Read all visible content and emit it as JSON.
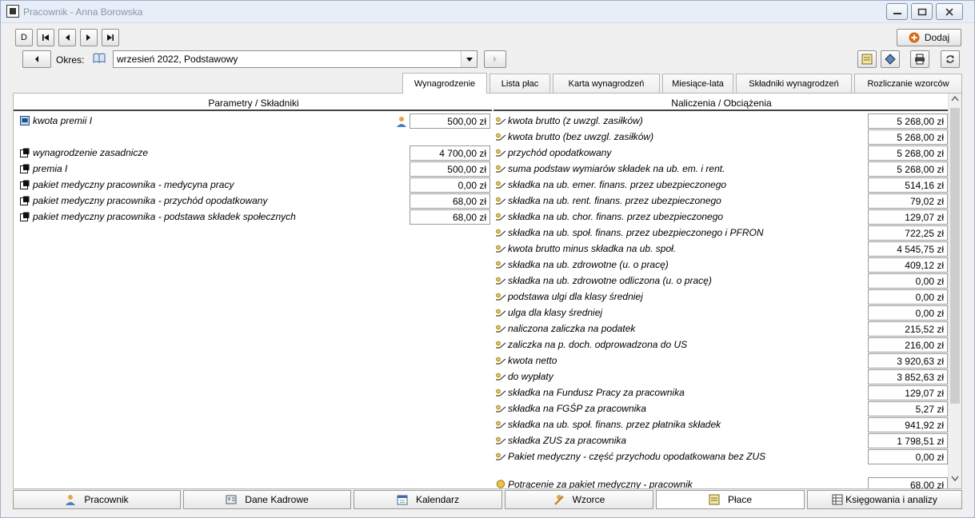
{
  "window": {
    "title": "Pracownik - Anna Borowska"
  },
  "toolbar": {
    "nav_first": "D",
    "nav_prev_record": "⏮",
    "nav_prev": "◀",
    "nav_next": "▶",
    "nav_last": "⏭",
    "add_label": "Dodaj",
    "period_prev": "◀",
    "period_label": "Okres:",
    "period_value": "wrzesień 2022, Podstawowy",
    "period_next": "▶"
  },
  "tabs": [
    {
      "label": "Wynagrodzenie",
      "active": true
    },
    {
      "label": "Lista płac",
      "active": false
    },
    {
      "label": "Karta wynagrodzeń",
      "active": false
    },
    {
      "label": "Miesiące-lata",
      "active": false
    },
    {
      "label": "Składniki wynagrodzeń",
      "active": false
    },
    {
      "label": "Rozliczanie wzorców",
      "active": false
    }
  ],
  "left_header": "Parametry / Składniki",
  "right_header": "Naliczenia / Obciążenia",
  "parameters": [
    {
      "label": "kwota premii I",
      "value": "500,00 zł",
      "type": "param"
    },
    {
      "label": "wynagrodzenie zasadnicze",
      "value": "4 700,00 zł",
      "type": "component"
    },
    {
      "label": "premia I",
      "value": "500,00 zł",
      "type": "component"
    },
    {
      "label": "pakiet medyczny pracownika - medycyna pracy",
      "value": "0,00 zł",
      "type": "component"
    },
    {
      "label": "pakiet medyczny pracownika - przychód opodatkowany",
      "value": "68,00 zł",
      "type": "component"
    },
    {
      "label": "pakiet medyczny pracownika - podstawa składek społecznych",
      "value": "68,00 zł",
      "type": "component"
    }
  ],
  "calculations": [
    {
      "label": "kwota brutto (z uwzgl. zasiłków)",
      "value": "5 268,00 zł"
    },
    {
      "label": "kwota brutto (bez uwzgl. zasiłków)",
      "value": "5 268,00 zł"
    },
    {
      "label": "przychód opodatkowany",
      "value": "5 268,00 zł"
    },
    {
      "label": "suma podstaw wymiarów składek na ub. em. i rent.",
      "value": "5 268,00 zł"
    },
    {
      "label": "składka na ub. emer. finans. przez ubezpieczonego",
      "value": "514,16 zł"
    },
    {
      "label": "składka na ub. rent. finans. przez ubezpieczonego",
      "value": "79,02 zł"
    },
    {
      "label": "składka na ub. chor. finans. przez ubezpieczonego",
      "value": "129,07 zł"
    },
    {
      "label": "składka na ub. społ. finans. przez ubezpieczonego i PFRON",
      "value": "722,25 zł"
    },
    {
      "label": "kwota brutto minus składka na ub. społ.",
      "value": "4 545,75 zł"
    },
    {
      "label": "składka na ub. zdrowotne (u. o pracę)",
      "value": "409,12 zł"
    },
    {
      "label": "składka na ub. zdrowotne odliczona (u. o pracę)",
      "value": "0,00 zł"
    },
    {
      "label": "podstawa ulgi dla klasy średniej",
      "value": "0,00 zł"
    },
    {
      "label": "ulga dla klasy średniej",
      "value": "0,00 zł"
    },
    {
      "label": "naliczona zaliczka na podatek",
      "value": "215,52 zł"
    },
    {
      "label": "zaliczka na p. doch. odprowadzona do US",
      "value": "216,00 zł"
    },
    {
      "label": "kwota netto",
      "value": "3 920,63 zł"
    },
    {
      "label": "do wypłaty",
      "value": "3 852,63 zł"
    },
    {
      "label": "składka na Fundusz Pracy za pracownika",
      "value": "129,07 zł"
    },
    {
      "label": "składka na FGŚP za pracownika",
      "value": "5,27 zł"
    },
    {
      "label": "składka na ub. społ. finans. przez płatnika składek",
      "value": "941,92 zł"
    },
    {
      "label": "składka ZUS za pracownika",
      "value": "1 798,51 zł"
    },
    {
      "label": "Pakiet medyczny - część przychodu opodatkowana bez ZUS",
      "value": "0,00 zł"
    }
  ],
  "calculations_partial": {
    "label": "Potrącenie za pakiet medyczny - pracownik",
    "value": "68,00 zł"
  },
  "bottom_tabs": [
    {
      "label": "Pracownik",
      "icon": "person-icon",
      "active": false
    },
    {
      "label": "Dane Kadrowe",
      "icon": "id-card-icon",
      "active": false
    },
    {
      "label": "Kalendarz",
      "icon": "calendar-icon",
      "active": false
    },
    {
      "label": "Wzorce",
      "icon": "pattern-icon",
      "active": false
    },
    {
      "label": "Płace",
      "icon": "payroll-icon",
      "active": true
    },
    {
      "label": "Księgowania i analizy",
      "icon": "ledger-icon",
      "active": false
    }
  ],
  "colors": {
    "accent": "#d96a10",
    "title_text": "#8a97a8",
    "panel_border": "#b7b7b7"
  }
}
